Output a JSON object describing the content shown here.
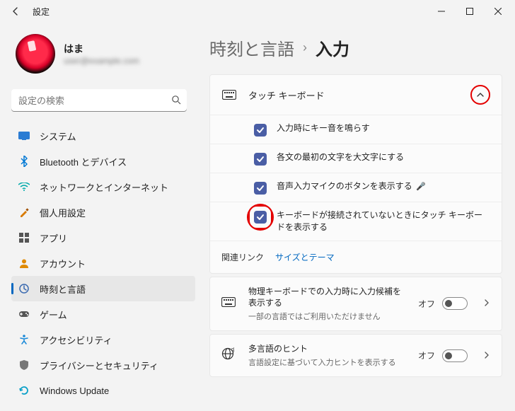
{
  "window": {
    "title": "設定"
  },
  "user": {
    "name": "はま",
    "email": "user@example.com"
  },
  "search": {
    "placeholder": "設定の検索"
  },
  "sidebar": {
    "items": [
      {
        "label": "システム",
        "icon": "system"
      },
      {
        "label": "Bluetooth とデバイス",
        "icon": "bluetooth"
      },
      {
        "label": "ネットワークとインターネット",
        "icon": "network"
      },
      {
        "label": "個人用設定",
        "icon": "personalize"
      },
      {
        "label": "アプリ",
        "icon": "apps"
      },
      {
        "label": "アカウント",
        "icon": "account"
      },
      {
        "label": "時刻と言語",
        "icon": "time",
        "active": true
      },
      {
        "label": "ゲーム",
        "icon": "game"
      },
      {
        "label": "アクセシビリティ",
        "icon": "accessibility"
      },
      {
        "label": "プライバシーとセキュリティ",
        "icon": "privacy"
      },
      {
        "label": "Windows Update",
        "icon": "update"
      }
    ]
  },
  "breadcrumb": {
    "parent": "時刻と言語",
    "current": "入力"
  },
  "touch_keyboard": {
    "title": "タッチ キーボード",
    "options": [
      {
        "label": "入力時にキー音を鳴らす",
        "checked": true
      },
      {
        "label": "各文の最初の文字を大文字にする",
        "checked": true
      },
      {
        "label": "音声入力マイクのボタンを表示する",
        "checked": true,
        "mic_suffix": true
      },
      {
        "label": "キーボードが接続されていないときにタッチ キーボードを表示する",
        "checked": true,
        "highlight": true
      }
    ],
    "related": {
      "label": "関連リンク",
      "link": "サイズとテーマ"
    }
  },
  "rows": [
    {
      "title": "物理キーボードでの入力時に入力候補を表示する",
      "sub": "一部の言語ではご利用いただけません",
      "toggle": "オフ",
      "icon": "keyboard"
    },
    {
      "title": "多言語のヒント",
      "sub": "言語設定に基づいて入力ヒントを表示する",
      "toggle": "オフ",
      "icon": "globe"
    }
  ]
}
